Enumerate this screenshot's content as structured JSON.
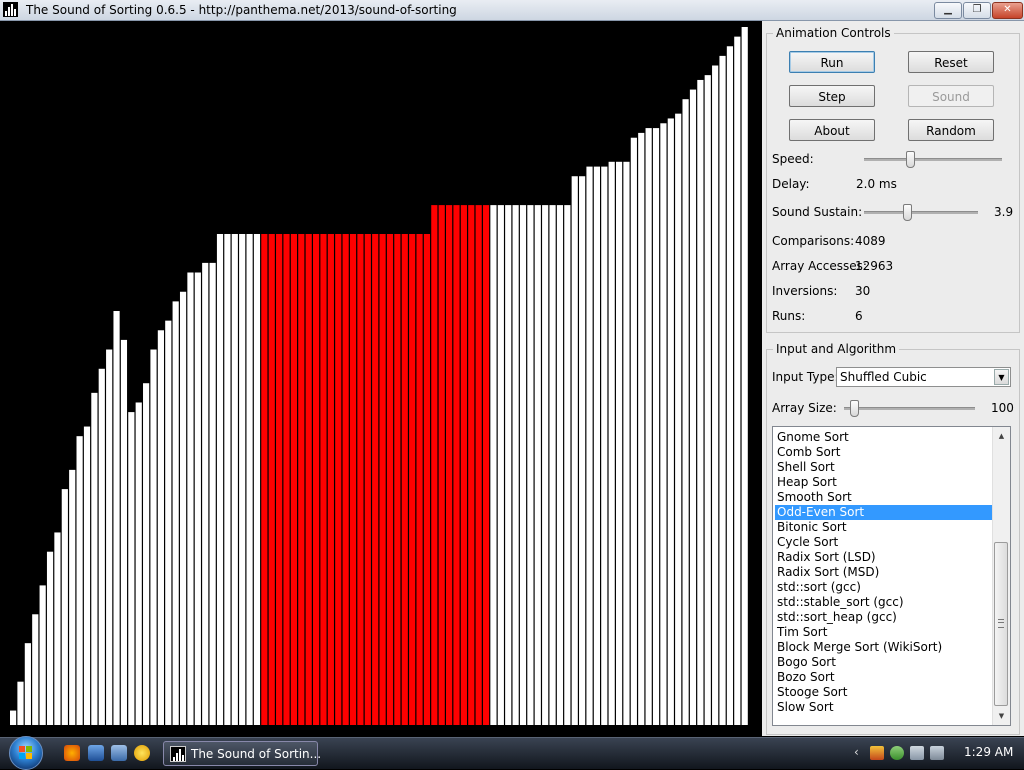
{
  "window": {
    "title": "The Sound of Sorting 0.6.5 - http://panthema.net/2013/sound-of-sorting",
    "minimize_glyph": "▁",
    "maximize_glyph": "❐",
    "close_glyph": "✕"
  },
  "visualization": {
    "array_max": 100,
    "values": [
      3,
      9,
      17,
      23,
      29,
      36,
      40,
      49,
      53,
      60,
      62,
      69,
      74,
      78,
      86,
      80,
      65,
      67,
      71,
      78,
      82,
      84,
      88,
      90,
      94,
      94,
      96,
      96,
      102,
      102,
      102,
      102,
      102,
      102,
      102,
      102,
      102,
      102,
      102,
      102,
      102,
      102,
      102,
      102,
      102,
      102,
      102,
      102,
      102,
      102,
      102,
      102,
      102,
      102,
      102,
      102,
      102,
      108,
      108,
      108,
      108,
      108,
      108,
      108,
      108,
      108,
      108,
      108,
      108,
      108,
      108,
      108,
      108,
      108,
      108,
      108,
      114,
      114,
      116,
      116,
      116,
      117,
      117,
      117,
      122,
      123,
      124,
      124,
      125,
      126,
      127,
      130,
      132,
      134,
      135,
      137,
      139,
      141,
      143,
      145
    ],
    "_comment_highlight": "indices of bars drawn in red",
    "highlight_color": "#ff0000",
    "bar_color": "#ffffff",
    "background_color": "#000000"
  },
  "animation_controls": {
    "legend": "Animation Controls",
    "buttons": {
      "run": "Run",
      "reset": "Reset",
      "step": "Step",
      "sound": "Sound",
      "about": "About",
      "random": "Random"
    },
    "speed_label": "Speed:",
    "speed_level": 0.33,
    "delay_label": "Delay:",
    "delay_value": "2.0 ms",
    "sustain_label": "Sound Sustain:",
    "sustain_value": "3.9",
    "sustain_level": 0.38,
    "comparisons_label": "Comparisons:",
    "comparisons_value": "4089",
    "array_accesses_label": "Array Accesses:",
    "array_accesses_value": "12963",
    "inversions_label": "Inversions:",
    "inversions_value": "30",
    "runs_label": "Runs:",
    "runs_value": "6"
  },
  "input_algorithm": {
    "legend": "Input and Algorithm",
    "input_type_label": "Input Type:",
    "input_type_value": "Shuffled Cubic",
    "array_size_label": "Array Size:",
    "array_size_value": "100",
    "array_size_level": 0.08,
    "algorithms": [
      "Gnome Sort",
      "Comb Sort",
      "Shell Sort",
      "Heap Sort",
      "Smooth Sort",
      "Odd-Even Sort",
      "Bitonic Sort",
      "Cycle Sort",
      "Radix Sort (LSD)",
      "Radix Sort (MSD)",
      "std::sort (gcc)",
      "std::stable_sort (gcc)",
      "std::sort_heap (gcc)",
      "Tim Sort",
      "Block Merge Sort (WikiSort)",
      "Bogo Sort",
      "Bozo Sort",
      "Stooge Sort",
      "Slow Sort"
    ],
    "selected_algorithm": "Odd-Even Sort",
    "selection_color": "#3399ff"
  },
  "taskbar": {
    "task_label": "The Sound of Sortin...",
    "clock": "1:29 AM",
    "tray_chevron": "‹"
  }
}
